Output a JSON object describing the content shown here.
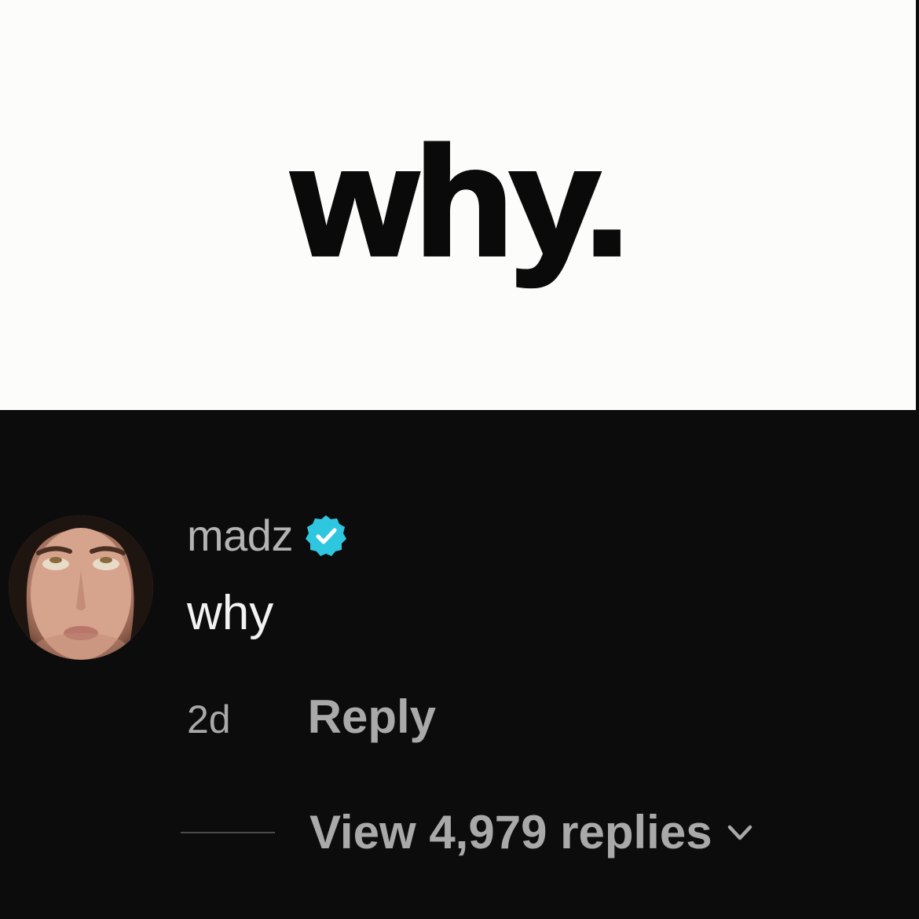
{
  "banner": {
    "text": "why."
  },
  "comment": {
    "avatar_icon": "avatar-photo",
    "username": "madz",
    "verified_icon": "verified-badge-icon",
    "verified_color": "#2fc6e0",
    "text": "why",
    "time": "2d",
    "reply_label": "Reply",
    "view_replies_label": "View 4,979 replies",
    "expand_icon": "chevron-down-icon"
  }
}
